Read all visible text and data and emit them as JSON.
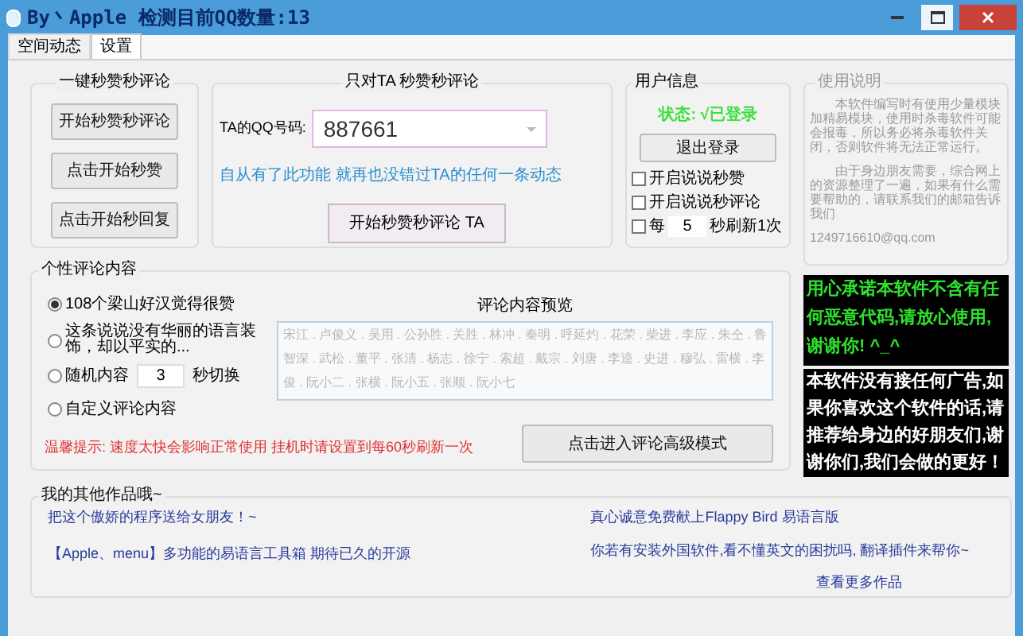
{
  "window": {
    "title": "By丶Apple 检测目前QQ数量:13"
  },
  "tabs": [
    {
      "label": "空间动态",
      "selected": false
    },
    {
      "label": "设置",
      "selected": true
    }
  ],
  "quick_group": {
    "title": "一键秒赞秒评论",
    "buttons": [
      "开始秒赞秒评论",
      "点击开始秒赞",
      "点击开始秒回复"
    ]
  },
  "target_group": {
    "title": "只对TA  秒赞秒评论",
    "field_label": "TA的QQ号码:",
    "qq_value": "887661",
    "slogan": "自从有了此功能 就再也没错过TA的任何一条动态",
    "button": "开始秒赞秒评论 TA"
  },
  "user_group": {
    "title": "用户信息",
    "status": "状态: √已登录",
    "logout": "退出登录",
    "options": [
      {
        "kind": "plain",
        "label": "开启说说秒赞",
        "checked": false
      },
      {
        "kind": "plain",
        "label": "开启说说秒评论",
        "checked": false
      },
      {
        "kind": "interval",
        "prefix": "每",
        "value": "5",
        "suffix": "秒刷新1次",
        "checked": false
      }
    ]
  },
  "help_group": {
    "title": "使用说明",
    "paragraphs": [
      "本软件编写时有使用少量模块加精易模块，使用时杀毒软件可能会报毒，所以务必将杀毒软件关闭，否则软件将无法正常运行。",
      "由于身边朋友需要，综合网上的资源整理了一遍，如果有什么需要帮助的，请联系我们的邮箱告诉我们",
      "1249716610@qq.com"
    ],
    "notices": [
      {
        "kind": "promise",
        "text": "用心承诺本软件不含有任何恶意代码,请放心使用,谢谢你! ^_^"
      },
      {
        "kind": "ad",
        "text": "本软件没有接任何广告,如果你喜欢这个软件的话,请推荐给身边的好朋友们,谢谢你们,我们会做的更好！"
      }
    ]
  },
  "comment_group": {
    "title": "个性评论内容",
    "options": [
      {
        "kind": "plain",
        "label": "108个梁山好汉觉得很赞",
        "selected": true
      },
      {
        "kind": "plain",
        "label": "这条说说没有华丽的语言装饰，却以平实的...",
        "selected": false
      },
      {
        "kind": "interval",
        "prefix": "随机内容",
        "value": "3",
        "suffix": "秒切换",
        "selected": false
      },
      {
        "kind": "plain",
        "label": "自定义评论内容",
        "selected": false
      }
    ],
    "preview_label": "评论内容预览",
    "preview_text": "宋江 . 卢俊义 . 吴用 . 公孙胜 . 关胜 . 林冲 . 秦明 . 呼延灼 . 花荣 . 柴进 . 李应 . 朱仝 . 鲁智深 . 武松 . 董平 . 张清 . 杨志 . 徐宁 . 索超 . 戴宗 . 刘唐 . 李逵 . 史进 . 穆弘 . 雷横 . 李俊 . 阮小二 . 张横 . 阮小五 . 张顺 . 阮小七",
    "warning": "温馨提示: 速度太快会影响正常使用 挂机时请设置到每60秒刷新一次",
    "advanced_button": "点击进入评论高级模式"
  },
  "works_group": {
    "title": "我的其他作品哦~",
    "left_links": [
      "把这个傲娇的程序送给女朋友！~",
      "【Apple、menu】多功能的易语言工具箱 期待已久的开源"
    ],
    "right_links": [
      "真心诚意免费献上Flappy Bird 易语言版",
      "你若有安装外国软件,看不懂英文的困扰吗, 翻译插件来帮你~",
      "查看更多作品"
    ]
  }
}
